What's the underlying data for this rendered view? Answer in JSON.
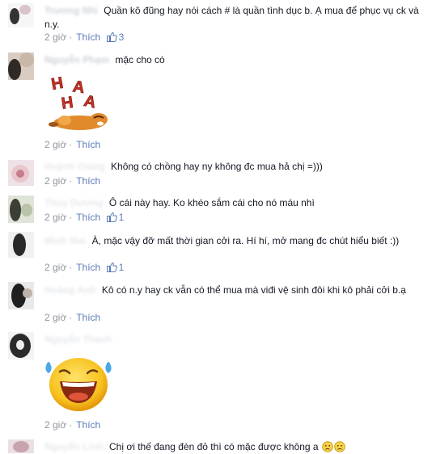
{
  "comments": [
    {
      "author": "Trương Nhi",
      "text": "Quần kô đũng hay nói cách # là quần tình dục b. Ạ mua để phục vụ ck và n.y.",
      "time": "2 giờ",
      "like_label": "Thích",
      "likes": "3"
    },
    {
      "author": "Nguyễn Phạm",
      "text": "mặc cho có",
      "time": "2 giờ",
      "like_label": "Thích"
    },
    {
      "author": "Huỳnh Giang",
      "text": "Không có chồng hay ny không đc mua hả chị =)))",
      "time": "2 giờ",
      "like_label": "Thích"
    },
    {
      "author": "Thùy Dương",
      "text": "Ô cái này hay. Ko khéo sắm cái cho nó máu nhì",
      "time": "2 giờ",
      "like_label": "Thích",
      "likes": "1"
    },
    {
      "author": "Minh Mai",
      "text": "À, mặc vậy đỡ mất thời gian cởi ra. Hí hí, mở mang đc chút hiểu biết :))",
      "time": "2 giờ",
      "like_label": "Thích",
      "likes": "1"
    },
    {
      "author": "Hoàng Anh",
      "text": "Kô có n.y hay ck vẫn có thể mua mà viđi vệ sinh đôi khi kô phải cởi b.ạ",
      "time": "2 giờ",
      "like_label": "Thích"
    },
    {
      "author": "Nguyễn Thanh",
      "text": "",
      "time": "2 giờ",
      "like_label": "Thích"
    },
    {
      "author": "Nguyễn Linh",
      "text": "Chị ơi thế đang đèn đỏ thì có mặc được không a"
    }
  ],
  "sticker_text": "HAHA",
  "colors": {
    "meta": "#90949c",
    "link": "#5b7bb7",
    "text": "#141823"
  }
}
